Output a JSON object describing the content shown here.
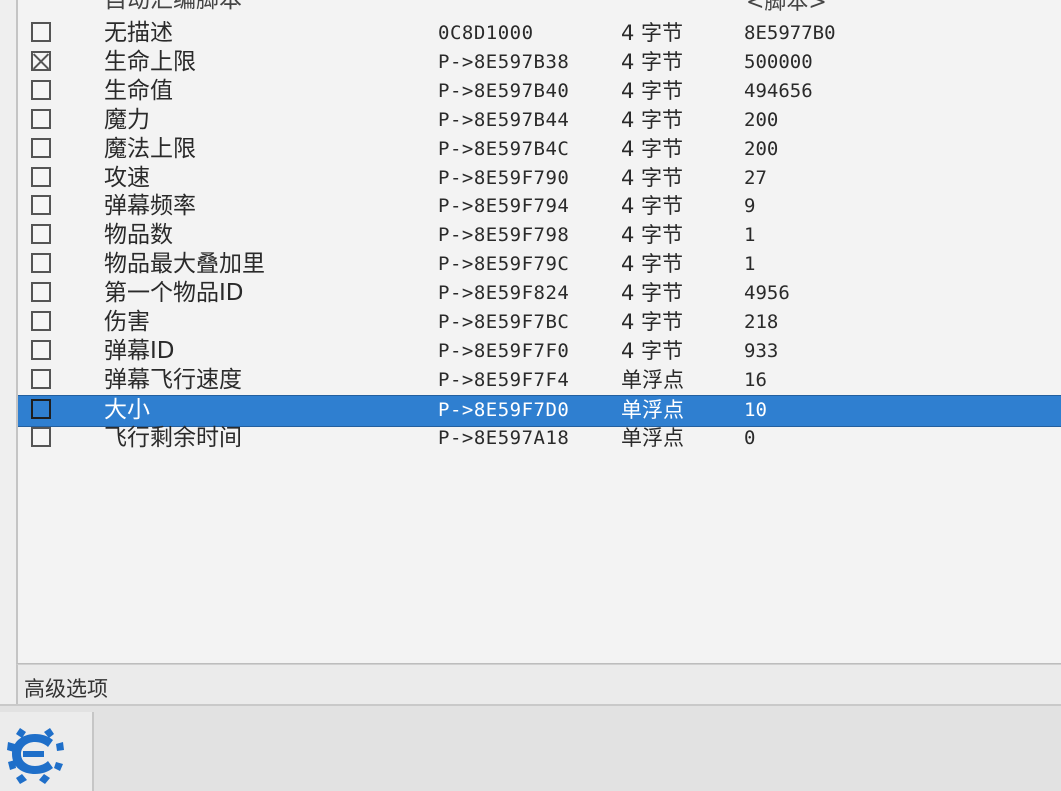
{
  "header": {
    "partial_label": "自动汇编脚本",
    "script_value": "<脚本>"
  },
  "rows": [
    {
      "checked": false,
      "desc": "无描述",
      "addr": "0C8D1000",
      "type": "4 字节",
      "value": "8E5977B0"
    },
    {
      "checked": true,
      "desc": "生命上限",
      "addr": "P->8E597B38",
      "type": "4 字节",
      "value": "500000"
    },
    {
      "checked": false,
      "desc": "生命值",
      "addr": "P->8E597B40",
      "type": "4 字节",
      "value": "494656"
    },
    {
      "checked": false,
      "desc": "魔力",
      "addr": "P->8E597B44",
      "type": "4 字节",
      "value": "200"
    },
    {
      "checked": false,
      "desc": "魔法上限",
      "addr": "P->8E597B4C",
      "type": "4 字节",
      "value": "200"
    },
    {
      "checked": false,
      "desc": "攻速",
      "addr": "P->8E59F790",
      "type": "4 字节",
      "value": "27"
    },
    {
      "checked": false,
      "desc": "弹幕频率",
      "addr": "P->8E59F794",
      "type": "4 字节",
      "value": "9"
    },
    {
      "checked": false,
      "desc": "物品数",
      "addr": "P->8E59F798",
      "type": "4 字节",
      "value": "1"
    },
    {
      "checked": false,
      "desc": "物品最大叠加里",
      "addr": "P->8E59F79C",
      "type": "4 字节",
      "value": "1"
    },
    {
      "checked": false,
      "desc": "第一个物品ID",
      "addr": "P->8E59F824",
      "type": "4 字节",
      "value": "4956"
    },
    {
      "checked": false,
      "desc": "伤害",
      "addr": "P->8E59F7BC",
      "type": "4 字节",
      "value": "218"
    },
    {
      "checked": false,
      "desc": "弹幕ID",
      "addr": "P->8E59F7F0",
      "type": "4 字节",
      "value": "933"
    },
    {
      "checked": false,
      "desc": "弹幕飞行速度",
      "addr": "P->8E59F7F4",
      "type": "单浮点",
      "value": "16"
    },
    {
      "checked": false,
      "desc": "大小",
      "addr": "P->8E59F7D0",
      "type": "单浮点",
      "value": "10",
      "selected": true
    },
    {
      "checked": false,
      "desc": "飞行剩余时间",
      "addr": "P->8E597A18",
      "type": "单浮点",
      "value": "0"
    }
  ],
  "footer": {
    "advanced_label": "高级选项"
  },
  "icons": {
    "logo": "cheat-engine-logo-icon"
  },
  "colors": {
    "selection": "#2f7fd0",
    "logo": "#1f6fc9"
  }
}
